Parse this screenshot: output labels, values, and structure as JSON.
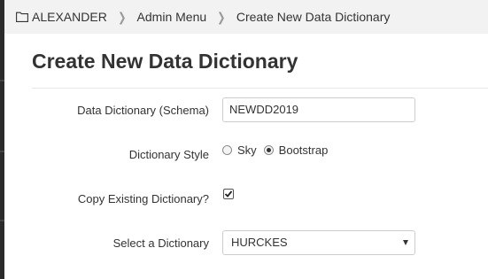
{
  "breadcrumb": {
    "items": [
      {
        "label": "ALEXANDER",
        "icon": "folder-icon"
      },
      {
        "label": "Admin Menu"
      },
      {
        "label": "Create New Data Dictionary"
      }
    ]
  },
  "page": {
    "title": "Create New Data Dictionary"
  },
  "form": {
    "schema_label": "Data Dictionary (Schema)",
    "schema_value": "NEWDD2019",
    "style_label": "Dictionary Style",
    "style_options": [
      {
        "label": "Sky",
        "checked": false
      },
      {
        "label": "Bootstrap",
        "checked": true
      }
    ],
    "copy_label": "Copy Existing Dictionary?",
    "copy_checked": true,
    "select_label": "Select a Dictionary",
    "select_value": "HURCKES"
  },
  "colors": {
    "background": "#f2f2f2",
    "panel": "#ffffff",
    "text": "#333333",
    "rail": "#2b2b2b"
  }
}
